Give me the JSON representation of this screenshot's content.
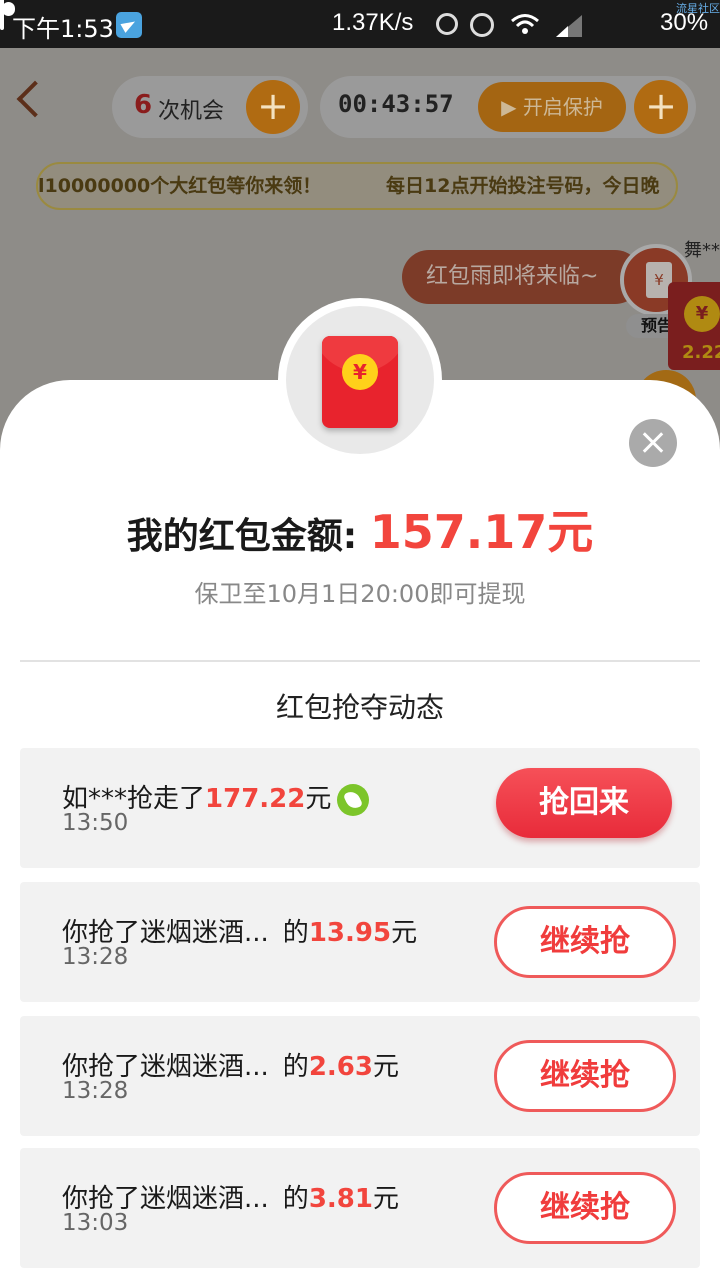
{
  "status_bar": {
    "time": "下午1:53",
    "speed": "1.37K/s",
    "battery_pct": "30%",
    "battery_level": 0.3,
    "watermark": "流星社区"
  },
  "background": {
    "chances": {
      "count": "6",
      "label": "次机会"
    },
    "countdown": "00:43:57",
    "protect_label": "开启保护",
    "plus_symbol": "+",
    "marquee_left": "l10000000个大红包等你来领！",
    "marquee_right": "每日12点开始投注号码，今日晚",
    "rain_bubble": "红包雨即将来临~",
    "preview_label": "预告",
    "yuan_symbol": "¥",
    "peek_user": "舞**",
    "peek_amount": "2.22"
  },
  "modal": {
    "amount_label": "我的红包金额: ",
    "amount_value": "157.17元",
    "withdraw_note": "保卫至10月1日20:00即可提现",
    "feed_title": "红包抢夺动态",
    "feed": [
      {
        "text": "如***抢走了",
        "amount": "177.22",
        "unit": "元",
        "time": "13:50",
        "button": "抢回来",
        "button_style": "solid",
        "icon": "leaf-icon"
      },
      {
        "text": "你抢了迷烟迷酒...",
        "suffix": "的",
        "amount": "13.95",
        "unit": "元",
        "time": "13:28",
        "button": "继续抢",
        "button_style": "outline"
      },
      {
        "text": "你抢了迷烟迷酒...",
        "suffix": "的",
        "amount": "2.63",
        "unit": "元",
        "time": "13:28",
        "button": "继续抢",
        "button_style": "outline"
      },
      {
        "text": "你抢了迷烟迷酒...",
        "suffix": "的",
        "amount": "3.81",
        "unit": "元",
        "time": "13:03",
        "button": "继续抢",
        "button_style": "outline"
      }
    ]
  },
  "colors": {
    "accent_red": "#f2453d",
    "button_red": "#e82b3a",
    "overlay_gray": "#8e8c88"
  }
}
